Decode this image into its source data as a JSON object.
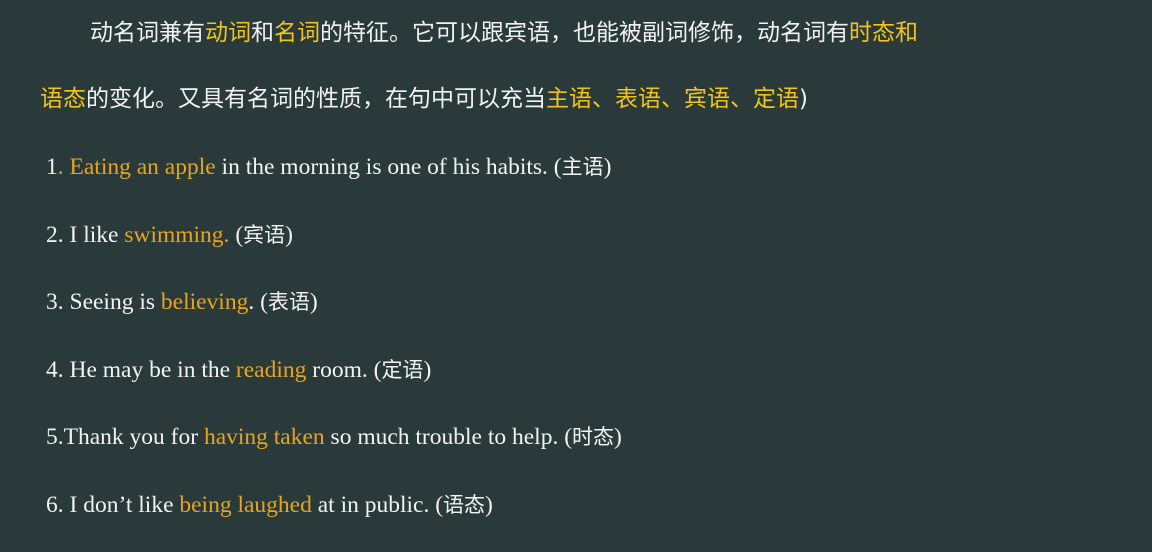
{
  "intro": {
    "line1": {
      "t1": "动名词兼有",
      "h1": "动词",
      "t2": "和",
      "h2": "名词",
      "t3": "的特征。它可以跟宾语，也能被副词修饰，动名词有",
      "h3": "时态和"
    },
    "line2": {
      "h1": "语态",
      "t1": "的变化。又具有名词的性质，在句中可以充当",
      "h2": "主语、表语、宾语、定语",
      "t2": ")"
    }
  },
  "examples": [
    {
      "prefix": "1",
      "dot": ".",
      "sp": " ",
      "highlight": "Eating an apple",
      "suffix": " in the morning is one of his habits. (",
      "role": "主语",
      "close": ")"
    },
    {
      "prefix": "2. I like ",
      "dot": "",
      "sp": "",
      "highlight": "swimming.",
      "suffix": " (",
      "role": "宾语",
      "close": ")"
    },
    {
      "prefix": "3. Seeing is ",
      "dot": "",
      "sp": "",
      "highlight": "believing",
      "suffix": ". (",
      "role": "表语",
      "close": ")"
    },
    {
      "prefix": "4. He may be in the ",
      "dot": "",
      "sp": "",
      "highlight": "reading",
      "suffix": " room. (",
      "role": "定语",
      "close": ")"
    },
    {
      "prefix": "5.Thank you for ",
      "dot": "",
      "sp": "",
      "highlight": "having taken",
      "suffix": " so much trouble to help. (",
      "role": "时态",
      "close": ")"
    },
    {
      "prefix": "6. I don’t like ",
      "dot": "",
      "sp": "",
      "highlight": "being laughed",
      "suffix": " at in public. (",
      "role": "语态",
      "close": ")"
    }
  ],
  "colors": {
    "background": "#2a3a3a",
    "text": "#f2f2f2",
    "intro_highlight": "#f0c419",
    "example_highlight": "#e6a51e"
  }
}
